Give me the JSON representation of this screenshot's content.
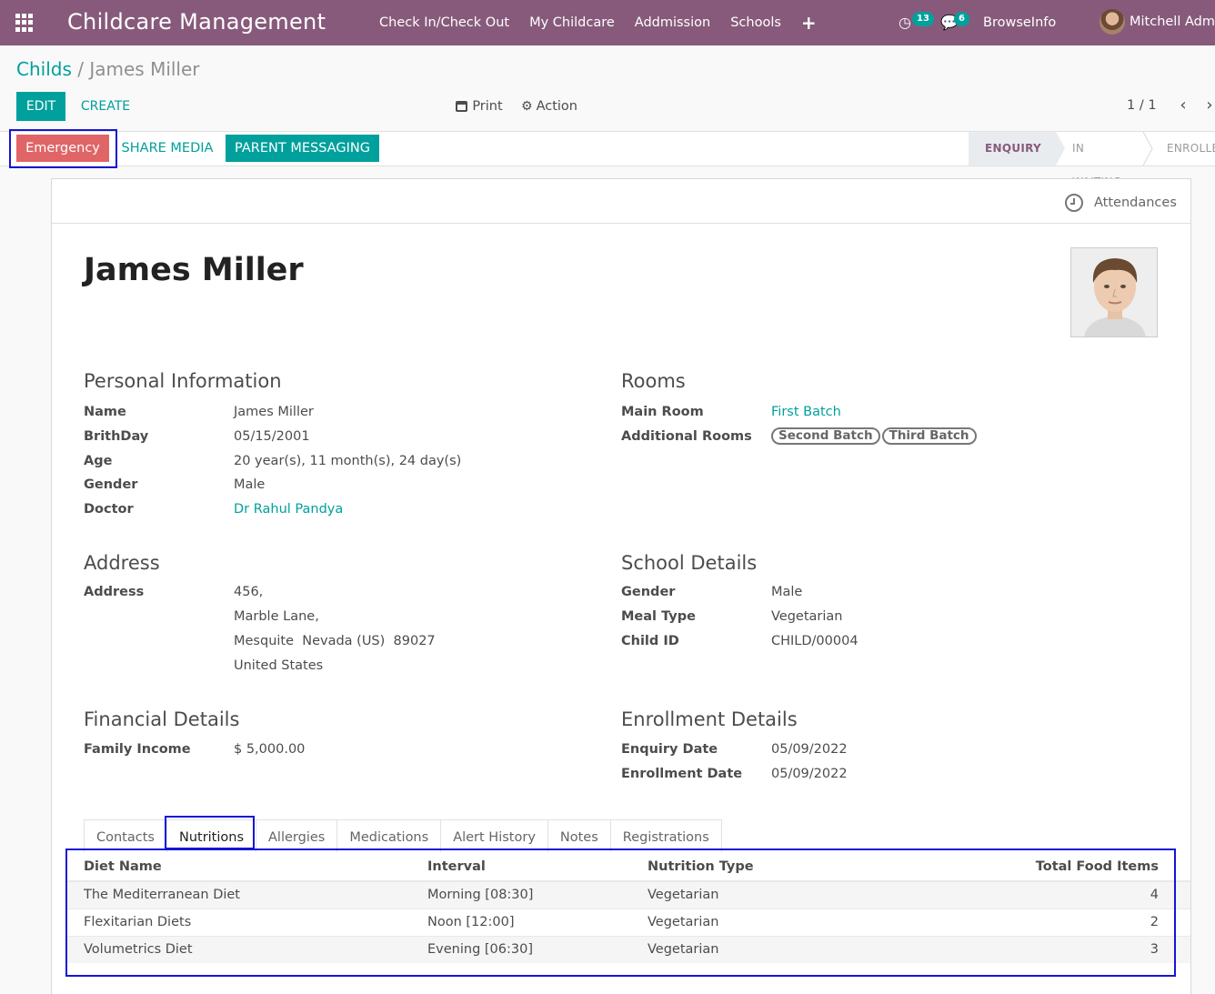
{
  "nav": {
    "brand": "Childcare Management",
    "menu": [
      "Check In/Check Out",
      "My Childcare",
      "Addmission",
      "Schools"
    ],
    "plus": "+",
    "activity_count": "13",
    "message_count": "6",
    "company": "BrowseInfo",
    "user": "Mitchell Admin"
  },
  "breadcrumb": {
    "parent": "Childs",
    "sep": "/",
    "current": "James Miller"
  },
  "toolbar": {
    "edit": "EDIT",
    "create": "CREATE",
    "print": "Print",
    "action": "Action",
    "pager": "1 / 1"
  },
  "statusbar": {
    "emergency": "Emergency",
    "share_media": "SHARE MEDIA",
    "parent_messaging": "PARENT MESSAGING",
    "stages": [
      "ENQUIRY",
      "IN WAITING",
      "ENROLLED"
    ]
  },
  "sheet": {
    "attendances": "Attendances",
    "name": "James Miller"
  },
  "personal": {
    "title": "Personal Information",
    "labels": {
      "name": "Name",
      "birthday": "BrithDay",
      "age": "Age",
      "gender": "Gender",
      "doctor": "Doctor"
    },
    "values": {
      "name": "James Miller",
      "birthday": "05/15/2001",
      "age": "20 year(s), 11 month(s), 24 day(s)",
      "gender": "Male",
      "doctor": "Dr Rahul Pandya"
    }
  },
  "rooms": {
    "title": "Rooms",
    "labels": {
      "main": "Main Room",
      "additional": "Additional Rooms"
    },
    "main": "First Batch",
    "additional": [
      "Second Batch",
      "Third Batch"
    ]
  },
  "address": {
    "title": "Address",
    "label": "Address",
    "lines": [
      "456,",
      "Marble Lane,",
      "Mesquite  Nevada (US)  89027",
      "United States"
    ]
  },
  "school": {
    "title": "School Details",
    "labels": {
      "gender": "Gender",
      "meal": "Meal Type",
      "child_id": "Child ID"
    },
    "values": {
      "gender": "Male",
      "meal": "Vegetarian",
      "child_id": "CHILD/00004"
    }
  },
  "financial": {
    "title": "Financial Details",
    "label": "Family Income",
    "value": "$ 5,000.00"
  },
  "enrollment": {
    "title": "Enrollment Details",
    "labels": {
      "enquiry": "Enquiry Date",
      "enrollment": "Enrollment Date"
    },
    "values": {
      "enquiry": "05/09/2022",
      "enrollment": "05/09/2022"
    }
  },
  "tabs": [
    "Contacts",
    "Nutritions",
    "Allergies",
    "Medications",
    "Alert History",
    "Notes",
    "Registrations"
  ],
  "nutrition_table": {
    "headers": [
      "Diet Name",
      "Interval",
      "Nutrition Type",
      "Total Food Items"
    ],
    "rows": [
      [
        "The Mediterranean Diet",
        "Morning [08:30]",
        "Vegetarian",
        "4"
      ],
      [
        "Flexitarian Diets",
        "Noon [12:00]",
        "Vegetarian",
        "2"
      ],
      [
        "Volumetrics Diet",
        "Evening [06:30]",
        "Vegetarian",
        "3"
      ]
    ]
  },
  "colors": {
    "primary": "#875a7b",
    "accent": "#00a09d",
    "danger": "#e06566",
    "highlight": "#1515d6"
  },
  "icons": [
    "apps-grid-icon",
    "activity-clock-icon",
    "chat-bubble-icon",
    "print-icon",
    "gear-icon",
    "chevron-left-icon",
    "chevron-right-icon",
    "clock-icon"
  ]
}
